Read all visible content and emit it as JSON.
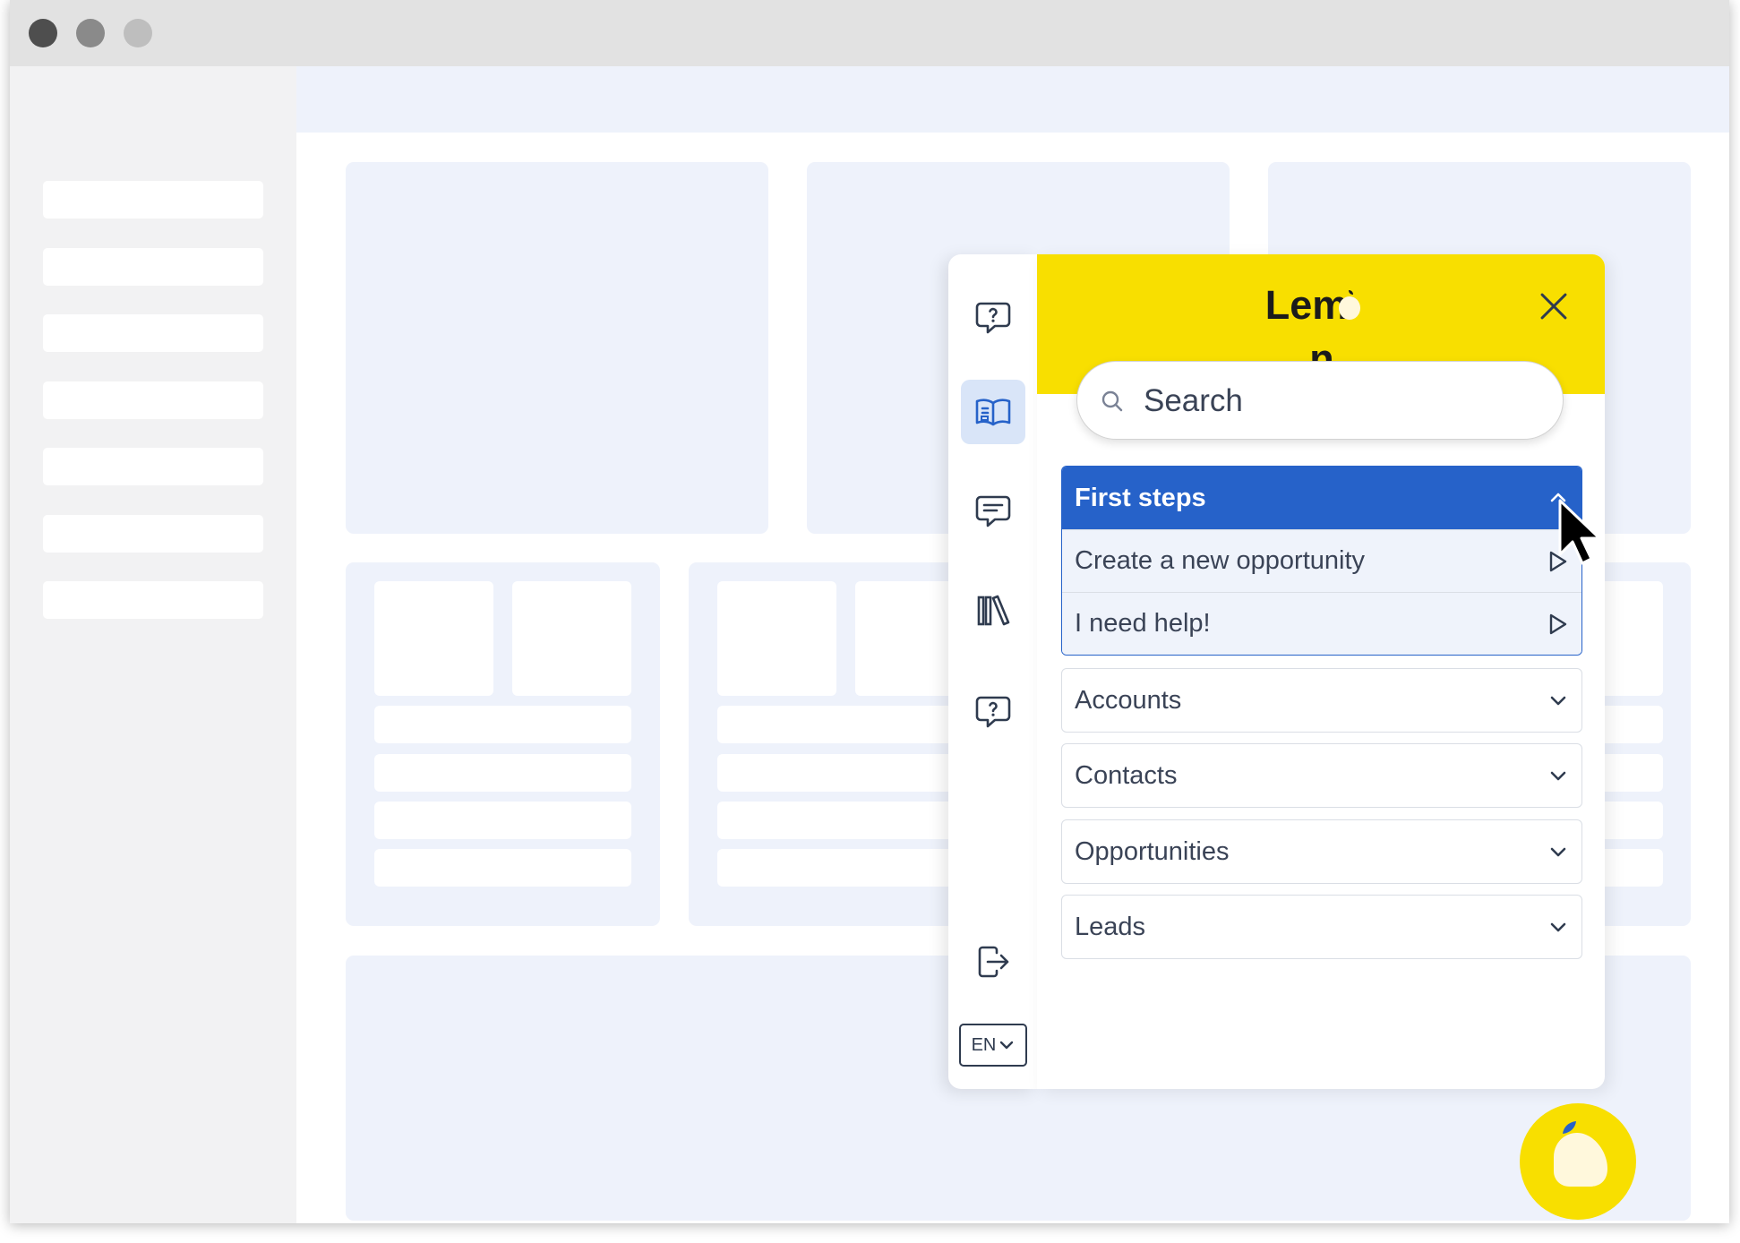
{
  "widget": {
    "brand_left": "Lem",
    "brand_right": "n",
    "search_placeholder": "Search",
    "language": "EN",
    "rail_icons": [
      "question-chat-icon",
      "book-icon",
      "message-icon",
      "library-icon",
      "question-chat-icon",
      "logout-icon"
    ],
    "sections": [
      {
        "label": "First steps",
        "expanded": true,
        "items": [
          {
            "label": "Create a new opportunity"
          },
          {
            "label": "I need help!"
          }
        ]
      },
      {
        "label": "Accounts",
        "expanded": false
      },
      {
        "label": "Contacts",
        "expanded": false
      },
      {
        "label": "Opportunities",
        "expanded": false
      },
      {
        "label": "Leads",
        "expanded": false
      }
    ]
  },
  "colors": {
    "brand_yellow": "#f8df00",
    "accent_blue": "#2662c9",
    "placeholder_bg": "#eef2fb",
    "text": "#3a4356"
  }
}
